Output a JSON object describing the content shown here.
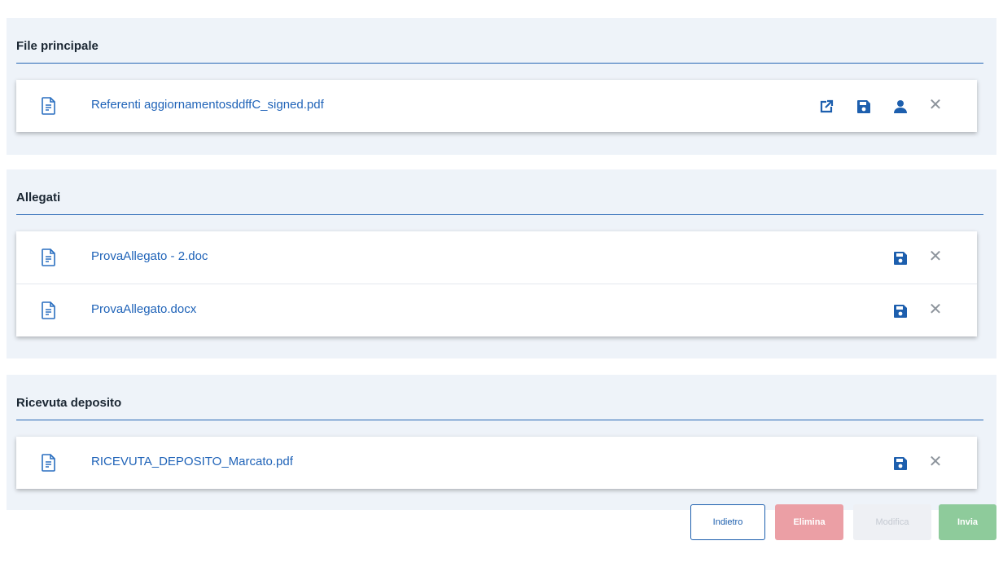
{
  "sections": [
    {
      "title": "File principale",
      "files": [
        {
          "name": "Referenti aggiornamentosddffC_signed.pdf",
          "actions": [
            "open-external-icon",
            "save-icon",
            "user-icon",
            "close-icon"
          ]
        }
      ]
    },
    {
      "title": "Allegati",
      "files": [
        {
          "name": "ProvaAllegato - 2.doc",
          "actions": [
            "save-icon",
            "close-icon"
          ]
        },
        {
          "name": "ProvaAllegato.docx",
          "actions": [
            "save-icon",
            "close-icon"
          ]
        }
      ]
    },
    {
      "title": "Ricevuta deposito",
      "files": [
        {
          "name": "RICEVUTA_DEPOSITO_Marcato.pdf",
          "actions": [
            "save-icon",
            "close-icon"
          ]
        }
      ]
    }
  ],
  "buttons": {
    "back": "Indietro",
    "delete": "Elimina",
    "edit": "Modifica",
    "send": "Invia"
  },
  "colors": {
    "accent": "#1f63b8",
    "section_bg": "#eef3f9",
    "delete_bg": "#eb9fa5",
    "edit_bg": "#eef0f4",
    "send_bg": "#8ecb9b"
  },
  "close_glyph": "✕"
}
